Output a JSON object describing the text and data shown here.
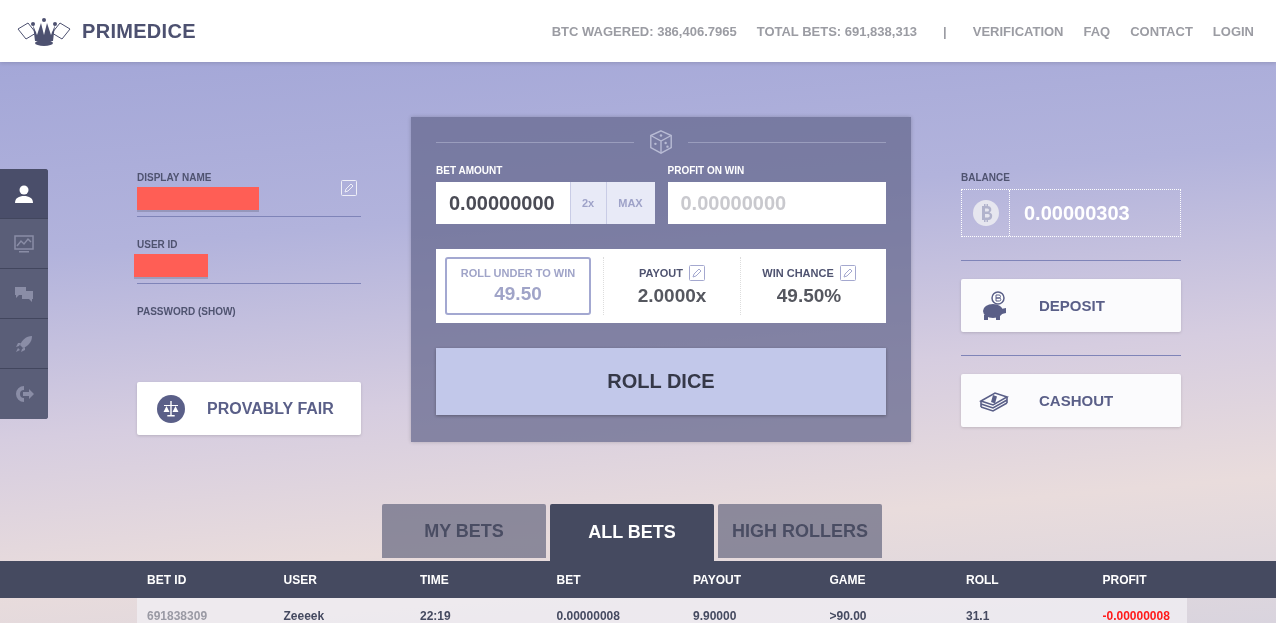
{
  "header": {
    "logo": "PRIMEDICE",
    "stats": [
      "BTC WAGERED: 386,406.7965",
      "TOTAL BETS: 691,838,313"
    ],
    "separator": "|",
    "links": [
      "VERIFICATION",
      "FAQ",
      "CONTACT",
      "LOGIN"
    ]
  },
  "side_nav": [
    {
      "kind": "user",
      "selected": true
    },
    {
      "kind": "chart",
      "selected": false
    },
    {
      "kind": "chat",
      "selected": false
    },
    {
      "kind": "rocket",
      "selected": false
    },
    {
      "kind": "logout",
      "selected": false
    }
  ],
  "account": {
    "fields": [
      {
        "label": "DISPLAY NAME",
        "editable": true,
        "redacted": true
      },
      {
        "label": "USER ID",
        "editable": false,
        "redacted": true
      },
      {
        "label": "PASSWORD (SHOW)",
        "editable": false,
        "redacted": false
      }
    ],
    "button": "PROVABLY FAIR"
  },
  "game": {
    "bet_amount": {
      "label": "BET AMOUNT",
      "value": "0.00000000",
      "buttons": [
        "2x",
        "MAX"
      ]
    },
    "profit_on_win": {
      "label": "PROFIT ON WIN",
      "placeholder": "0.00000000"
    },
    "stats": [
      {
        "kind": "toggle",
        "label": "ROLL UNDER TO WIN",
        "value": "49.50"
      },
      {
        "kind": "editable",
        "label": "PAYOUT",
        "value": "2.0000x"
      },
      {
        "kind": "editable",
        "label": "WIN CHANCE",
        "value": "49.50%"
      }
    ],
    "roll_button": "ROLL DICE"
  },
  "wallet": {
    "label": "BALANCE",
    "balance": "0.00000303",
    "actions": [
      {
        "kind": "deposit",
        "label": "DEPOSIT"
      },
      {
        "kind": "cashout",
        "label": "CASHOUT"
      }
    ]
  },
  "bets": {
    "tabs": [
      {
        "label": "MY BETS",
        "selected": false
      },
      {
        "label": "ALL BETS",
        "selected": true
      },
      {
        "label": "HIGH ROLLERS",
        "selected": false
      }
    ],
    "columns": [
      "BET ID",
      "USER",
      "TIME",
      "BET",
      "PAYOUT",
      "GAME",
      "ROLL",
      "PROFIT"
    ],
    "rows": [
      {
        "color": "#ff1a1a",
        "cells": [
          "691838309",
          "Zeeeek",
          "22:19",
          "0.00000008",
          "9.90000",
          ">90.00",
          "31.1",
          "-0.00000008"
        ]
      }
    ]
  }
}
